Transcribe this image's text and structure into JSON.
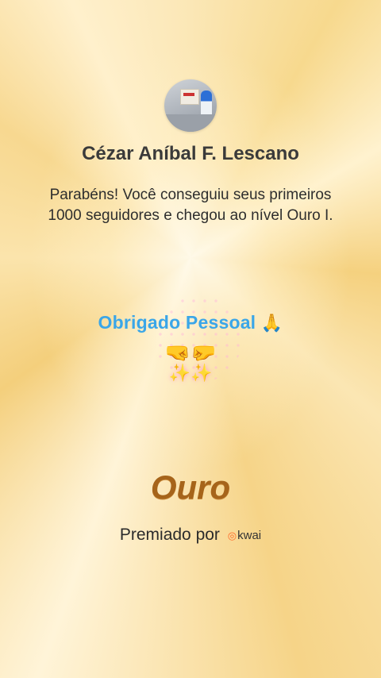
{
  "user": {
    "name": "Cézar Aníbal F. Lescano"
  },
  "message": "Parabéns! Você conseguiu seus primeiros 1000 seguidores e chegou ao nível Ouro I.",
  "overlay": {
    "thanks_text": "Obrigado Pessoal",
    "pray_emoji": "🙏",
    "fists_emoji": "🤜🤛",
    "sparkle_emoji": "✨✨"
  },
  "level": {
    "label": "Ouro"
  },
  "award": {
    "prefix": "Premiado por",
    "brand_icon": "kwai-logo-icon",
    "brand_name": "kwai"
  },
  "colors": {
    "thanks_text": "#3aa6e8",
    "level_text": "#a6641a",
    "brand_accent": "#ff6a2a"
  }
}
